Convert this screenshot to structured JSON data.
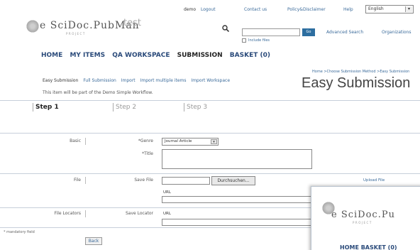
{
  "topbar": {
    "user": "demo",
    "logout": "Logout",
    "contact": "Contact us",
    "policy": "Policy&Disclaimer",
    "help": "Help",
    "language": "English"
  },
  "header": {
    "logo": "e SciDoc.PubMan",
    "logo_sub": "PROJECT",
    "instance": "test",
    "search_go": "Go",
    "include_files": "Include files",
    "advanced_search": "Advanced Search",
    "organizations": "Organizations"
  },
  "mainnav": {
    "home": "HOME",
    "my_items": "MY ITEMS",
    "qa": "QA WORKSPACE",
    "submission": "SUBMISSION",
    "basket": "BASKET (0)"
  },
  "breadcrumb": "Home >Choose Submission Method >Easy Submission",
  "subnav": {
    "easy": "Easy Submission",
    "full": "Full Submission",
    "import": "Import",
    "import_multi": "Import multiple items",
    "import_ws": "Import Workspace"
  },
  "description": "This item will be part of the Demo Simple Workflow.",
  "page_title": "Easy Submission",
  "steps": [
    "Step 1",
    "Step 2",
    "Step 3"
  ],
  "form": {
    "basic_label": "Basic",
    "genre_label": "*Genre",
    "genre_value": "Journal Article",
    "title_label": "*Title",
    "file_label": "File",
    "save_file_label": "Save File",
    "browse_label": "Durchsuchen...",
    "upload_label": "Upload File",
    "url_label": "URL",
    "locators_label": "File Locators",
    "save_locator_label": "Save Locator",
    "url_label2": "URL"
  },
  "mandatory": "* mandatory field",
  "back_label": "Back",
  "popup": {
    "logo": "e SciDoc.Pu",
    "logo_sub": "PROJECT",
    "nav": "HOME   BASKET (0)"
  }
}
